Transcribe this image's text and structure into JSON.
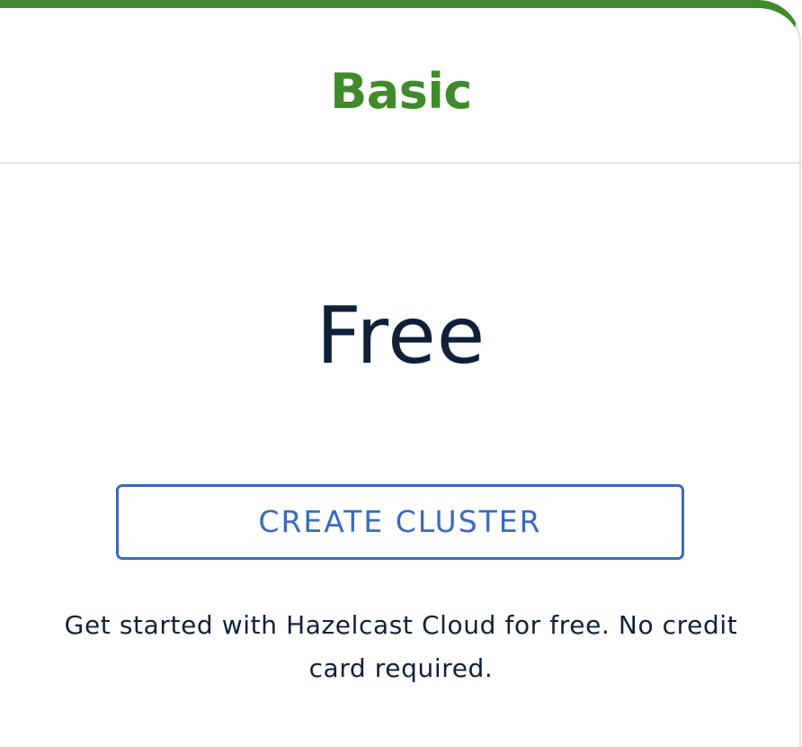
{
  "plan": {
    "name": "Basic",
    "price": "Free",
    "cta_label": "CREATE CLUSTER",
    "description": "Get started with Hazelcast Cloud for free. No credit card required."
  },
  "colors": {
    "accent_green": "#3f8a2a",
    "button_blue": "#3b6abf",
    "text_dark": "#102039"
  }
}
